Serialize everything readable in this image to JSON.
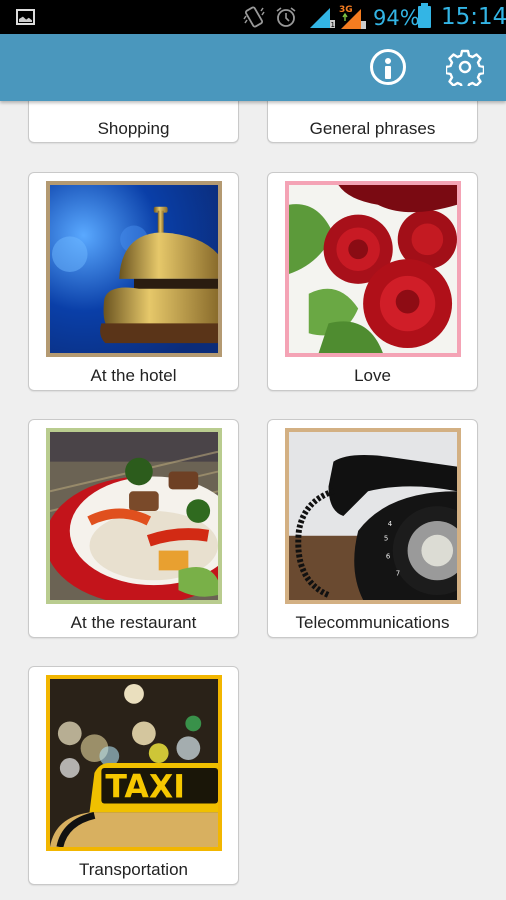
{
  "status_bar": {
    "icons": [
      "gallery-icon",
      "vibrate-icon",
      "alarm-icon",
      "signal-sim1-icon",
      "signal-sim2-3g-icon",
      "battery-icon"
    ],
    "network_label": "3G",
    "sim1": "1",
    "sim2": "2",
    "battery_percent": "94%",
    "time": "15:14",
    "accent_color": "#33b5e5"
  },
  "action_bar": {
    "color": "#4a97bd",
    "actions": [
      {
        "name": "info",
        "icon": "info-icon"
      },
      {
        "name": "settings",
        "icon": "gear-icon"
      }
    ]
  },
  "categories": [
    {
      "label": "Shopping",
      "partial": true
    },
    {
      "label": "General phrases",
      "partial": true
    },
    {
      "label": "At the hotel",
      "image": "hotel-bell-image",
      "frame_color": "#b49a72"
    },
    {
      "label": "Love",
      "image": "red-roses-image",
      "frame_color": "#f4a3b5"
    },
    {
      "label": "At the restaurant",
      "image": "food-plate-image",
      "frame_color": "#b9cc8f"
    },
    {
      "label": "Telecommunications",
      "image": "rotary-phone-image",
      "frame_color": "#d3b083"
    },
    {
      "label": "Transportation",
      "image": "taxi-sign-image",
      "frame_color": "#f2b600",
      "taxi_text": "TAXI"
    }
  ]
}
